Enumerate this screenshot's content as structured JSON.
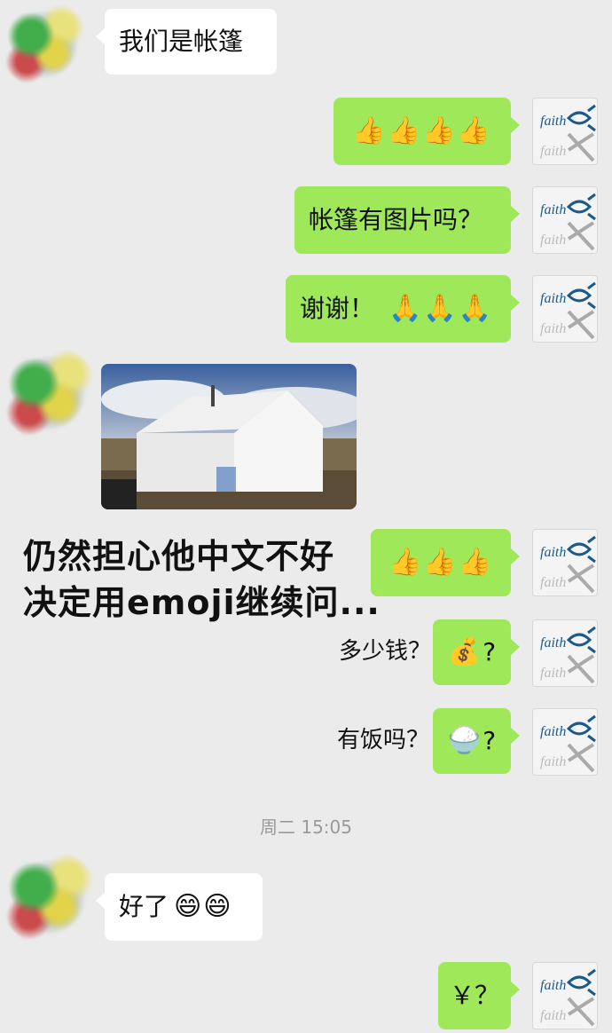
{
  "messages": {
    "m1": {
      "text": "我们是帐篷"
    },
    "m2": {
      "emoji": "👍👍👍👍"
    },
    "m3": {
      "text": "帐篷有图片吗？"
    },
    "m4": {
      "text": "谢谢！",
      "emoji": "🙏🙏🙏"
    },
    "m5": {
      "type": "image",
      "subject": "tent"
    },
    "m6": {
      "emoji": "👍👍👍"
    },
    "m7": {
      "emoji": "💰",
      "suffix": "?"
    },
    "m8": {
      "emoji": "🍚",
      "suffix": "?"
    },
    "m9": {
      "text": "好了",
      "emoji": "😄😄"
    },
    "m10": {
      "text": "￥？"
    }
  },
  "annotations": {
    "big_line1": "仍然担心他中文不好",
    "big_line2": "决定用emoji继续问...",
    "money_label": "多少钱？",
    "rice_label": "有饭吗？"
  },
  "timestamp": "周二 15:05",
  "avatar_right": {
    "text": "faith",
    "icon": "fish-icon"
  },
  "colors": {
    "background": "#ebebeb",
    "bubble_right": "#9fe85a",
    "bubble_left": "#ffffff",
    "timestamp": "#9a9a9a"
  }
}
